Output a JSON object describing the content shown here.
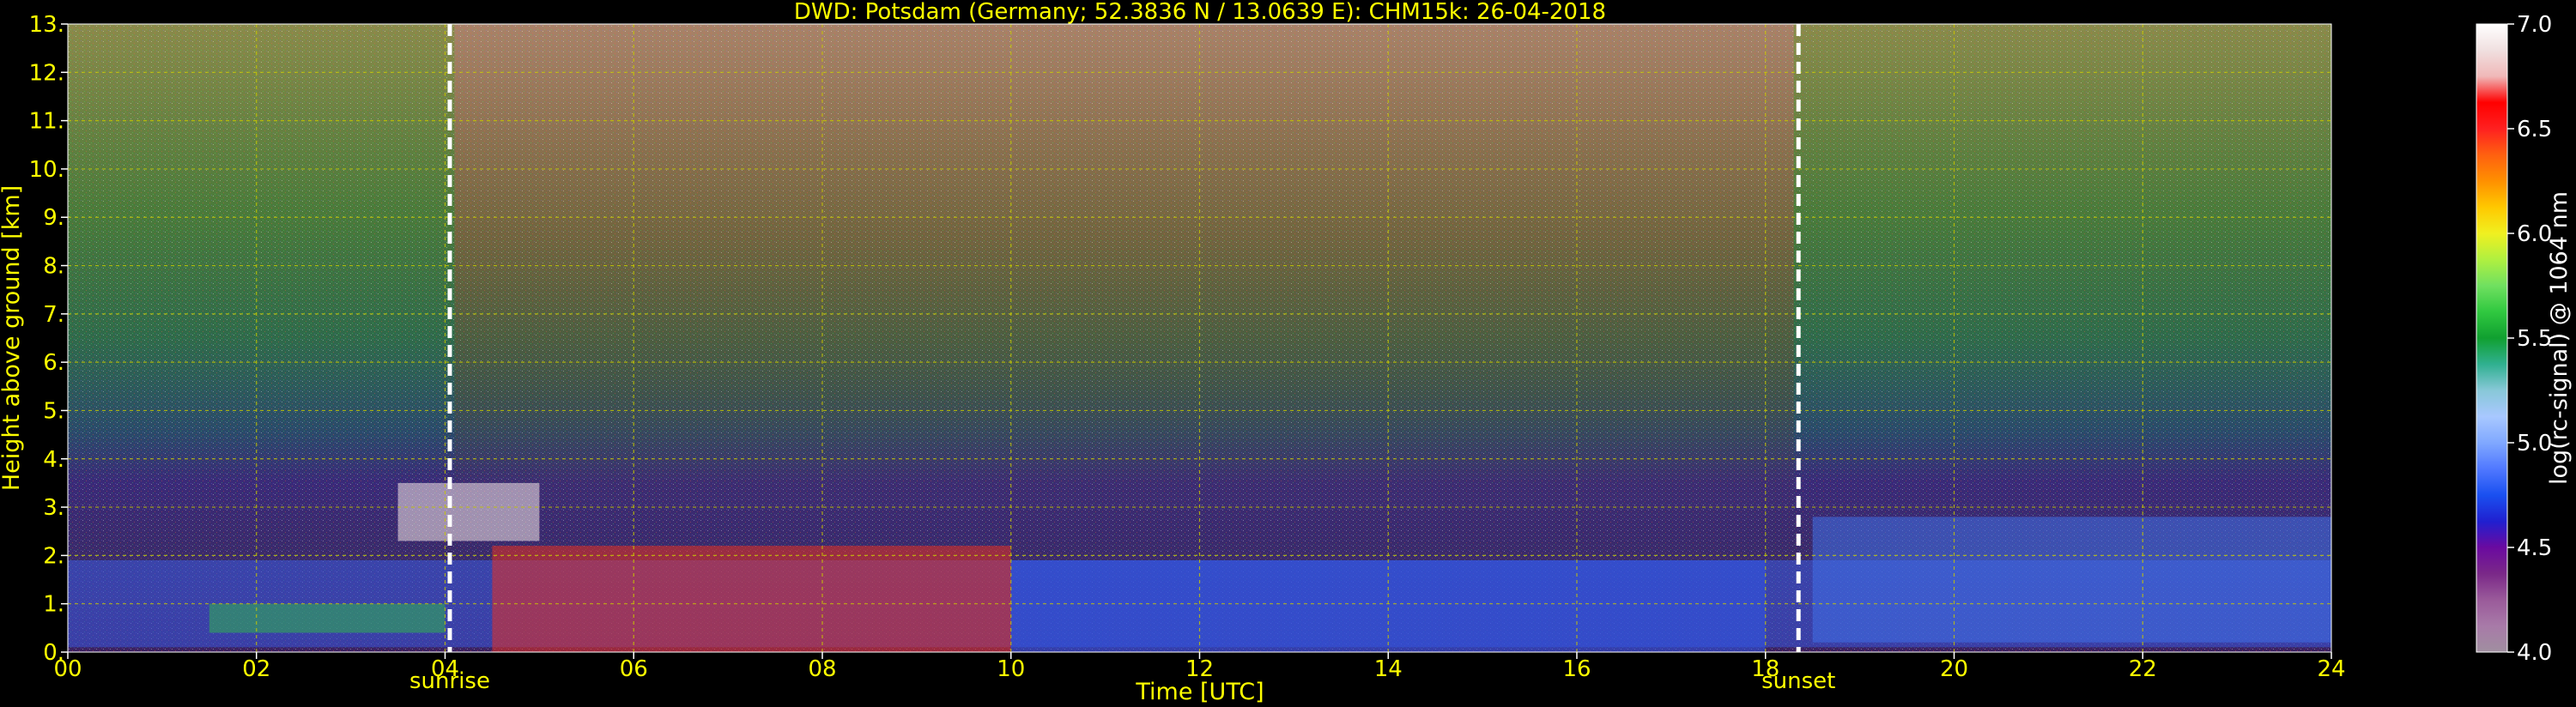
{
  "chart_data": {
    "type": "heatmap",
    "title": "DWD: Potsdam (Germany; 52.3836 N / 13.0639 E):    CHM15k: 26-04-2018",
    "xlabel": "Time [UTC]",
    "ylabel": "Height above ground [km]",
    "xlim": [
      0,
      24
    ],
    "ylim": [
      0,
      13
    ],
    "x_ticks": [
      "00",
      "02",
      "04",
      "06",
      "08",
      "10",
      "12",
      "14",
      "16",
      "18",
      "20",
      "22",
      "24"
    ],
    "y_ticks": [
      "0.",
      "1.",
      "2.",
      "3.",
      "4.",
      "5.",
      "6.",
      "7.",
      "8.",
      "9.",
      "10.",
      "11.",
      "12.",
      "13."
    ],
    "grid": true,
    "markers": [
      {
        "label": "sunrise",
        "x": 4.05
      },
      {
        "label": "sunset",
        "x": 18.35
      }
    ],
    "colorbar": {
      "label": "log(rc-signal) @ 1064 nm",
      "range": [
        4.0,
        7.0
      ],
      "ticks": [
        "4.0",
        "4.5",
        "5.0",
        "5.5",
        "6.0",
        "6.5",
        "7.0"
      ],
      "colors": [
        "#a08fa0",
        "#a87aa8",
        "#9a5a9a",
        "#7a2888",
        "#6a0aa0",
        "#2020d0",
        "#1a50f0",
        "#5078ff",
        "#80a8ff",
        "#a8c8ff",
        "#88c8d8",
        "#30b090",
        "#10a030",
        "#30c840",
        "#70e060",
        "#b0f040",
        "#f0f020",
        "#ffc800",
        "#ff9000",
        "#ff6010",
        "#ff2020",
        "#ff0000",
        "#f0b8b8",
        "#f0e0e0",
        "#ffffff"
      ]
    },
    "layers": [
      {
        "name": "boundary layer (blue)",
        "x": [
          0,
          24
        ],
        "y": [
          0.1,
          1.9
        ]
      },
      {
        "name": "aerosol layer (green)",
        "x": [
          1.5,
          4
        ],
        "y": [
          0.4,
          1.0
        ]
      },
      {
        "name": "cloud tops (white)",
        "x": [
          3.5,
          5.0
        ],
        "y": [
          2.3,
          3.5
        ]
      },
      {
        "name": "convective plumes (red/white)",
        "x": [
          4.5,
          10
        ],
        "y": [
          0,
          2.2
        ]
      },
      {
        "name": "afternoon boundary layer",
        "x": [
          10,
          18
        ],
        "y": [
          0,
          1.9
        ]
      },
      {
        "name": "evening layer",
        "x": [
          18.5,
          24
        ],
        "y": [
          0.2,
          2.8
        ]
      }
    ]
  }
}
